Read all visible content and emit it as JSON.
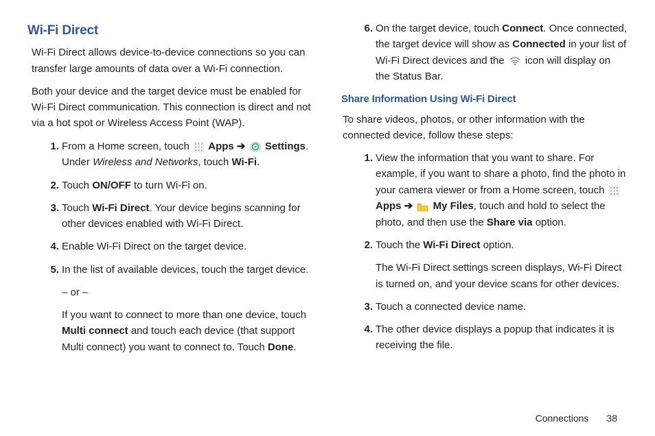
{
  "left": {
    "heading": "Wi-Fi Direct",
    "intro1": "Wi-Fi Direct allows device-to-device connections so you can transfer large amounts of data over a Wi-Fi connection.",
    "intro2": "Both your device and the target device must be enabled for Wi-Fi Direct communication. This connection is direct and not via a hot spot or Wireless Access Point (WAP).",
    "step1_a": "From a Home screen, touch ",
    "step1_apps": "Apps",
    "step1_arrow": " ➔ ",
    "step1_settings": "Settings",
    "step1_b": ". Under ",
    "step1_wn": "Wireless and Networks",
    "step1_c": ", touch ",
    "step1_wifi": "Wi-Fi",
    "step1_d": ".",
    "step2_a": "Touch ",
    "step2_onoff": "ON/OFF",
    "step2_b": " to turn Wi-Fi on.",
    "step3_a": "Touch ",
    "step3_wfd": "Wi-Fi Direct",
    "step3_b": ". Your device begins scanning for other devices enabled with Wi-Fi Direct.",
    "step4": "Enable Wi-Fi Direct on the target device.",
    "step5": "In the list of available devices, touch the target device.",
    "step5_or": "– or –",
    "step5_p2a": "If you want to connect to more than one device, touch ",
    "step5_mc": "Multi connect",
    "step5_p2b": " and touch each device (that support Multi connect) you want to connect to. Touch ",
    "step5_done": "Done",
    "step5_p2c": "."
  },
  "right": {
    "step6_a": "On the target device, touch ",
    "step6_connect": "Connect",
    "step6_b": ". Once connected, the target device will show as ",
    "step6_connected": "Connected",
    "step6_c": " in your list of Wi-Fi Direct devices and the ",
    "step6_d": " icon will display on the Status Bar.",
    "heading2": "Share Information Using Wi-Fi Direct",
    "intro": "To share videos, photos, or other information with the connected device, follow these steps:",
    "s1_a": "View the information that you want to share. For example, if you want to share a photo, find the photo in your camera viewer or from a Home screen, touch ",
    "s1_apps": "Apps",
    "s1_arrow": " ➔ ",
    "s1_myfiles": "My Files",
    "s1_b": ", touch and hold to select the photo, and then use the ",
    "s1_sharevia": "Share via",
    "s1_c": " option.",
    "s2_a": "Touch the ",
    "s2_wfd": "Wi-Fi Direct",
    "s2_b": " option.",
    "s2_p2": "The Wi-Fi Direct settings screen displays, Wi-Fi Direct is turned on, and your device scans for other devices.",
    "s3": "Touch a connected device name.",
    "s4": "The other device displays a popup that indicates it is receiving the file."
  },
  "footer": {
    "section": "Connections",
    "page": "38"
  }
}
